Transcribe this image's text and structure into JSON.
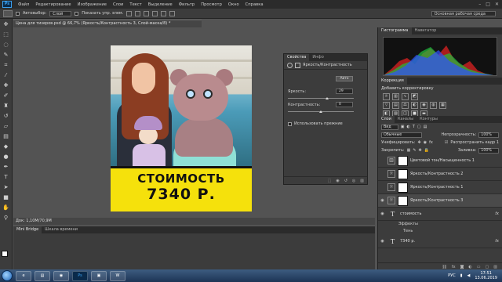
{
  "menubar": {
    "logo": "Ps",
    "items": [
      "Файл",
      "Редактирование",
      "Изображение",
      "Слои",
      "Текст",
      "Выделение",
      "Фильтр",
      "Просмотр",
      "Окно",
      "Справка"
    ]
  },
  "options": {
    "autoselect_label": "Автовыбор:",
    "autoselect_value": "Слой",
    "show_controls_label": "Показать упр. элем.",
    "workspace": "Основная рабочая среда"
  },
  "document": {
    "tab_title": "Цена для тизеров.psd @ 66,7% (Яркость/Контрастность 3, Слой-маска/8) *",
    "price_line1": "СТОИМОСТЬ",
    "price_line2": "7340 Р.",
    "status": "Док: 1,10М/70,9М",
    "price_band_color": "#f5e10c"
  },
  "properties": {
    "tabs": [
      "Свойства",
      "Инфо"
    ],
    "title": "Яркость/Контрастность",
    "auto_label": "Авто",
    "brightness_label": "Яркость:",
    "brightness_value": "29",
    "contrast_label": "Контрастность:",
    "contrast_value": "0",
    "legacy_label": "Использовать прежние"
  },
  "right_panel": {
    "histogram_tabs": [
      "Гистограмма",
      "Навигатор"
    ],
    "adjustments_tabs": [
      "Коррекция"
    ],
    "adjustments_title": "Добавить корректировку",
    "layers_tabs": [
      "Слои",
      "Каналы",
      "Контуры"
    ],
    "filter_label": "Вид",
    "blend_mode": "Обычные",
    "opacity_label": "Непрозрачность:",
    "opacity_value": "100%",
    "unify_label": "Унифицировать:",
    "propagate_label": "Распространить кадр 1",
    "lock_label": "Закрепить:",
    "fill_label": "Заливка:",
    "fill_value": "100%",
    "layers": [
      {
        "name": "Цветовой тон/Насыщенность 1",
        "type": "adj",
        "icon": "▥",
        "visible": false
      },
      {
        "name": "Яркость/Контрастность 2",
        "type": "adj",
        "icon": "☼",
        "visible": false
      },
      {
        "name": "Яркость/Контрастность 1",
        "type": "adj",
        "icon": "☼",
        "visible": false
      },
      {
        "name": "Яркость/Контрастность 3",
        "type": "adj",
        "icon": "☼",
        "visible": true,
        "selected": true
      }
    ],
    "text_layers": [
      {
        "name": "стоимость",
        "effects_label": "Эффекты",
        "effect": "Тень"
      },
      {
        "name": "7340 р.",
        "effects_label": "",
        "effect": ""
      }
    ]
  },
  "timeline": {
    "tabs": [
      "Mini Bridge",
      "Шкала времени"
    ]
  },
  "taskbar": {
    "apps": [
      "e",
      "▤",
      "◉",
      "Ps",
      "▣",
      "W"
    ],
    "lang": "РУС",
    "time": "17:51",
    "date": "13.06.2019"
  }
}
